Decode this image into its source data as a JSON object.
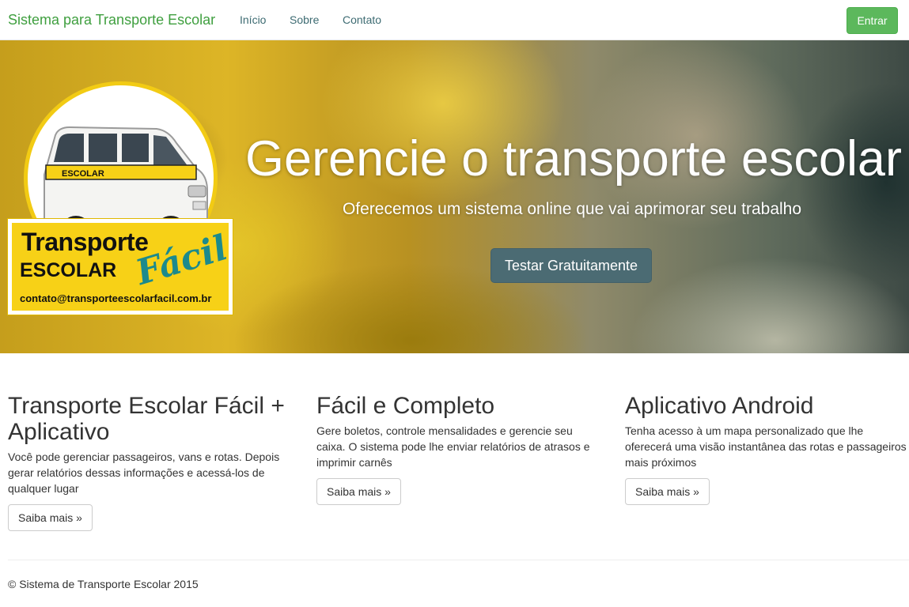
{
  "navbar": {
    "brand": "Sistema para Transporte Escolar",
    "links": [
      "Início",
      "Sobre",
      "Contato"
    ],
    "login_label": "Entrar"
  },
  "hero": {
    "title": "Gerencie o transporte escolar",
    "subtitle": "Oferecemos um sistema online que vai aprimorar seu trabalho",
    "cta_label": "Testar Gratuitamente",
    "logo": {
      "line1": "Transporte",
      "line2": "ESCOLAR",
      "script": "Fácil",
      "email": "contato@transporteescolarfacil.com.br",
      "van_text": "ESCOLAR"
    }
  },
  "features": [
    {
      "title": "Transporte Escolar Fácil + Aplicativo",
      "text": "Você pode gerenciar passageiros, vans e rotas. Depois gerar relatórios dessas informações e acessá-los de qualquer lugar",
      "button": "Saiba mais »"
    },
    {
      "title": "Fácil e Completo",
      "text": "Gere boletos, controle mensalidades e gerencie seu caixa. O sistema pode lhe enviar relatórios de atrasos e imprimir carnês",
      "button": "Saiba mais »"
    },
    {
      "title": "Aplicativo Android",
      "text": "Tenha acesso à um mapa personalizado que lhe oferecerá uma visão instantânea das rotas e passageiros mais próximos",
      "button": "Saiba mais »"
    }
  ],
  "footer": {
    "text": "© Sistema de Transporte Escolar 2015"
  },
  "colors": {
    "brand_green": "#3f9f3f",
    "login_button": "#5cb85c",
    "cta_button": "#4b6b73",
    "logo_yellow": "#f7d117"
  }
}
